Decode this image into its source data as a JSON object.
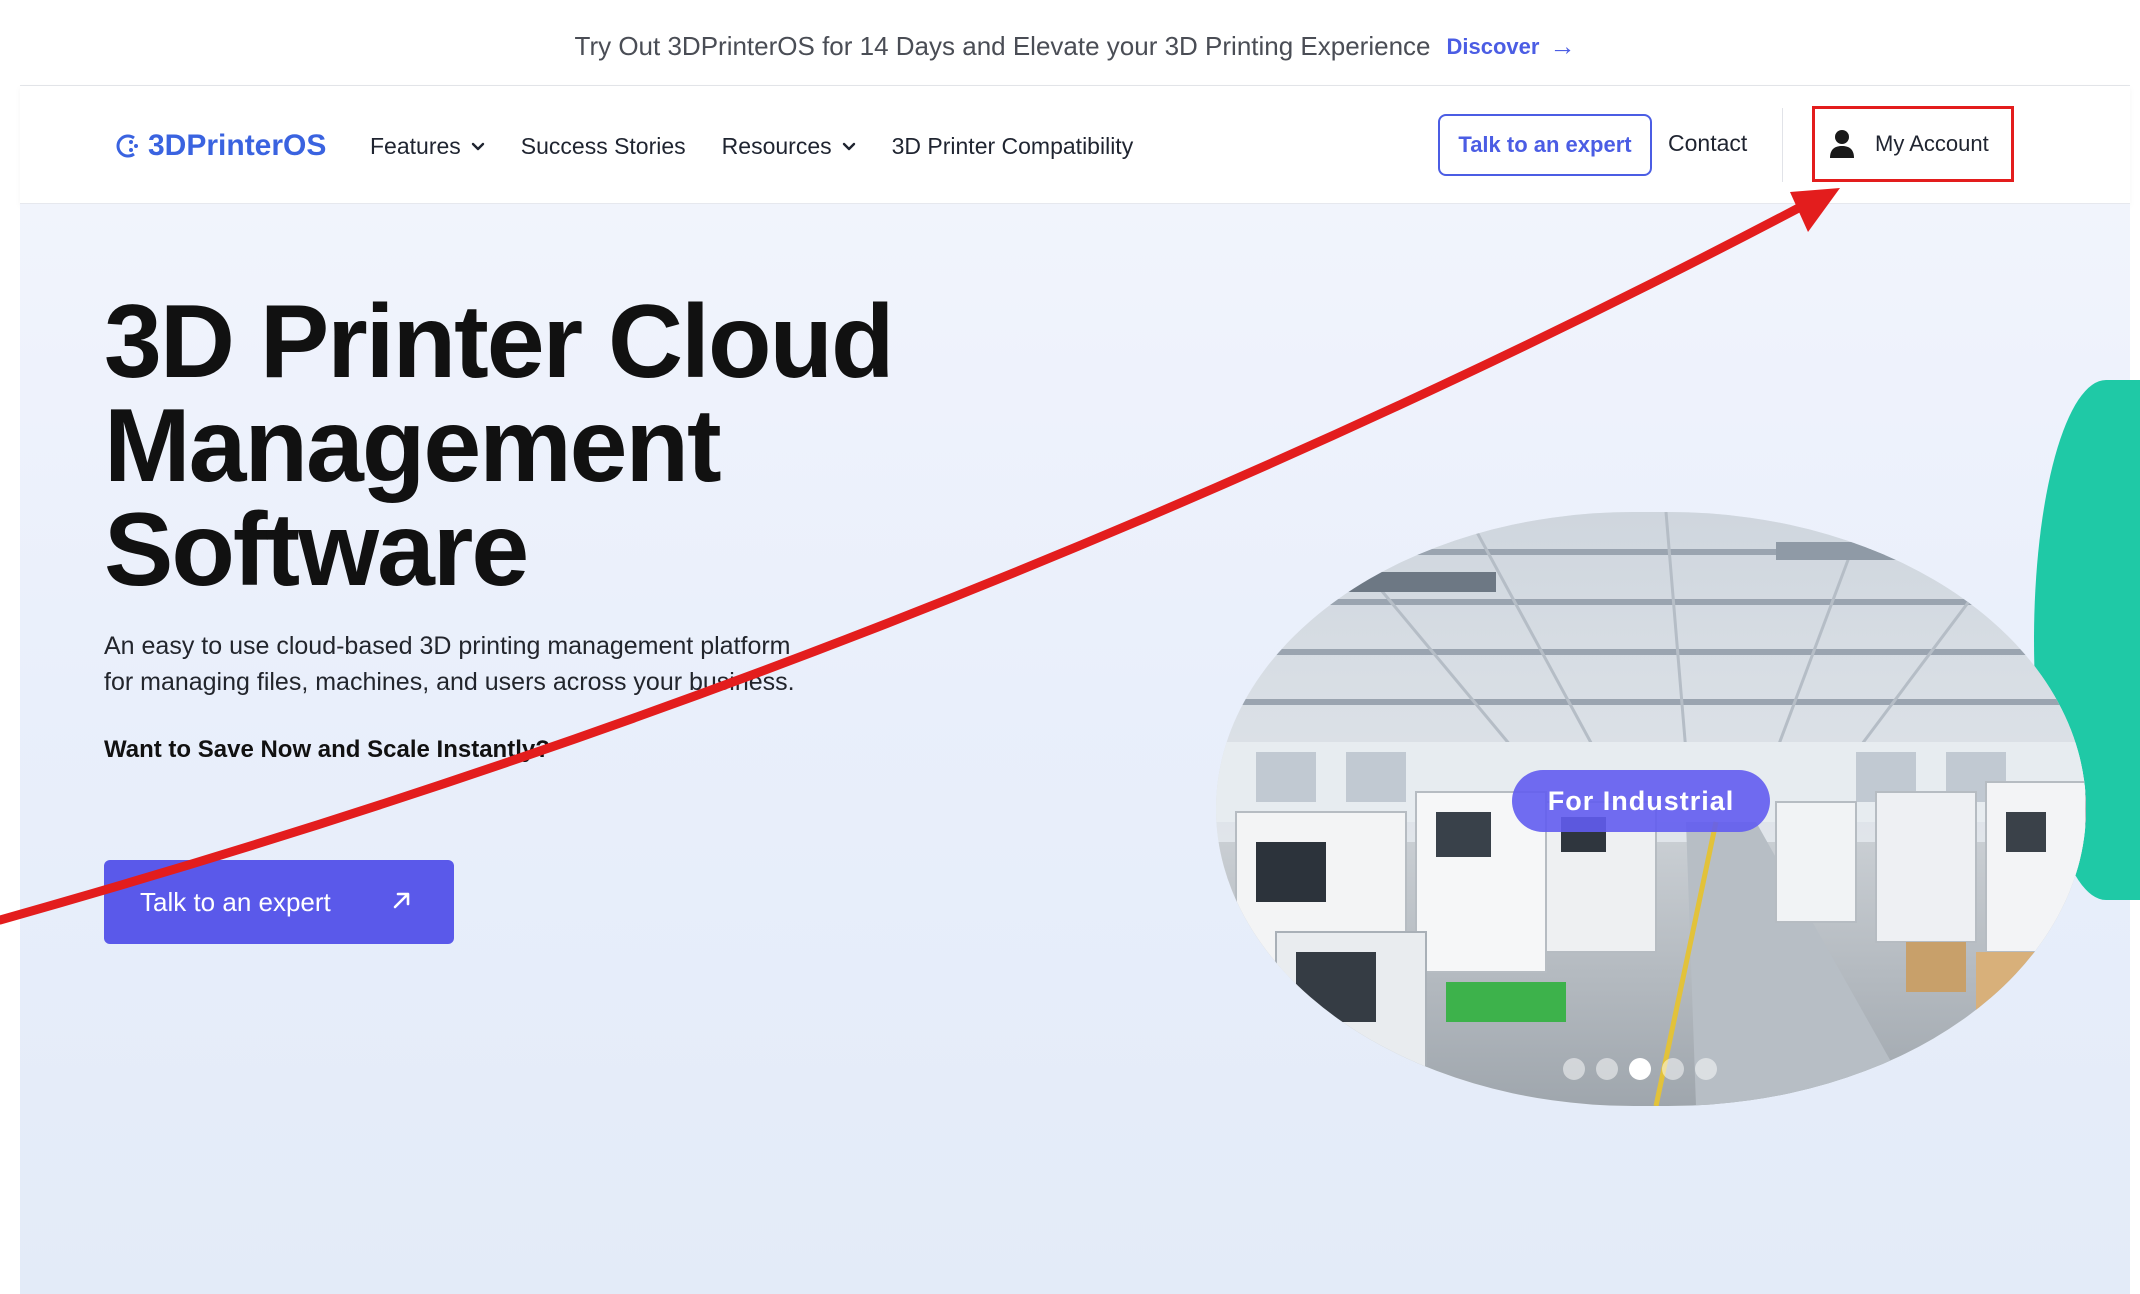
{
  "promo": {
    "text": "Try Out 3DPrinterOS for 14 Days and Elevate your 3D Printing Experience",
    "link_label": "Discover",
    "link_icon": "arrow-right-icon"
  },
  "nav": {
    "logo_text": "3DPrinterOS",
    "links": [
      {
        "label": "Features",
        "has_dropdown": true
      },
      {
        "label": "Success Stories",
        "has_dropdown": false
      },
      {
        "label": "Resources",
        "has_dropdown": true
      },
      {
        "label": "3D Printer Compatibility",
        "has_dropdown": false
      }
    ],
    "expert_button": "Talk to an expert",
    "contact": "Contact",
    "account": "My Account",
    "account_icon": "user-icon"
  },
  "hero": {
    "title_lines": [
      "3D Printer Cloud",
      "Management",
      "Software"
    ],
    "subtitle_lines": [
      "An easy to use cloud-based 3D printing management platform",
      "for managing files, machines, and users across your business."
    ],
    "question": "Want to Save Now and Scale Instantly?",
    "cta": "Talk to an expert",
    "cta_icon": "arrow-up-right-icon"
  },
  "carousel": {
    "badge": "For Industrial",
    "slide_count": 5,
    "active_slide": 3
  },
  "colors": {
    "brand_blue": "#3a63e0",
    "accent_purple": "#5a59ea",
    "annotation_red": "#e31d1d",
    "teal_accent": "#1fc9a6"
  }
}
